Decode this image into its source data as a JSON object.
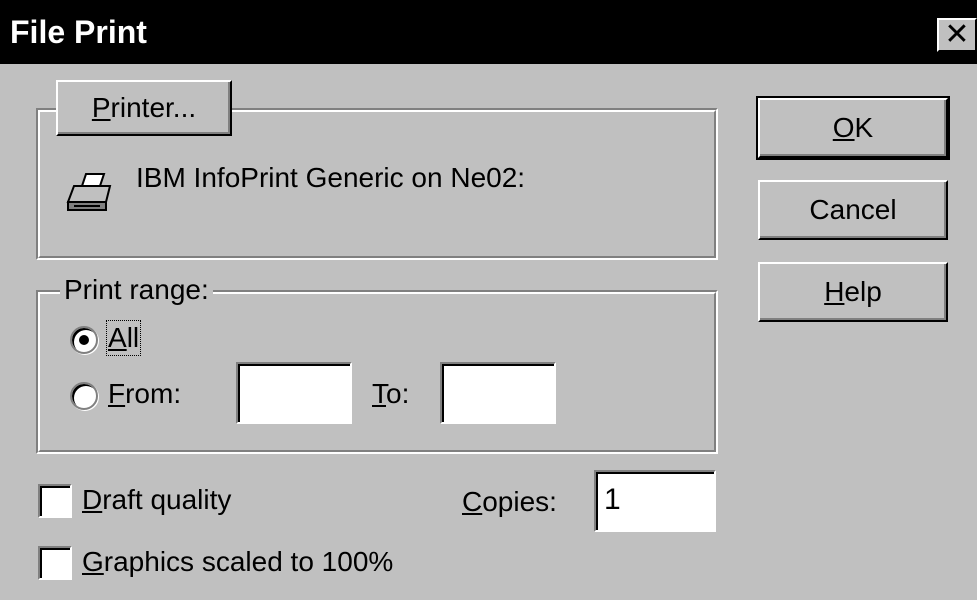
{
  "window": {
    "title": "File Print",
    "close_glyph": "✕"
  },
  "printer_group": {
    "button_text": "Printer...",
    "button_mnemonic": "P",
    "button_rest": "rinter...",
    "printer_name": "IBM InfoPrint Generic on Ne02:",
    "icon": "printer-icon"
  },
  "print_range": {
    "legend": "Print range:",
    "all_mnemonic": "A",
    "all_rest": "ll",
    "all_selected": true,
    "from_mnemonic": "F",
    "from_rest": "rom:",
    "from_value": "",
    "to_mnemonic": "T",
    "to_rest": "o:",
    "to_value": ""
  },
  "options": {
    "draft_mnemonic": "D",
    "draft_rest": "raft quality",
    "draft_checked": false,
    "graphics_mnemonic": "G",
    "graphics_rest": "raphics scaled to 100%",
    "graphics_checked": false,
    "copies_mnemonic": "C",
    "copies_rest": "opies:",
    "copies_value": "1"
  },
  "buttons": {
    "ok_mnemonic": "O",
    "ok_rest": "K",
    "cancel": "Cancel",
    "help_mnemonic": "H",
    "help_rest": "elp"
  },
  "colors": {
    "dialog_bg": "#c0c0c0",
    "titlebar_bg": "#000000",
    "titlebar_text": "#ffffff"
  }
}
